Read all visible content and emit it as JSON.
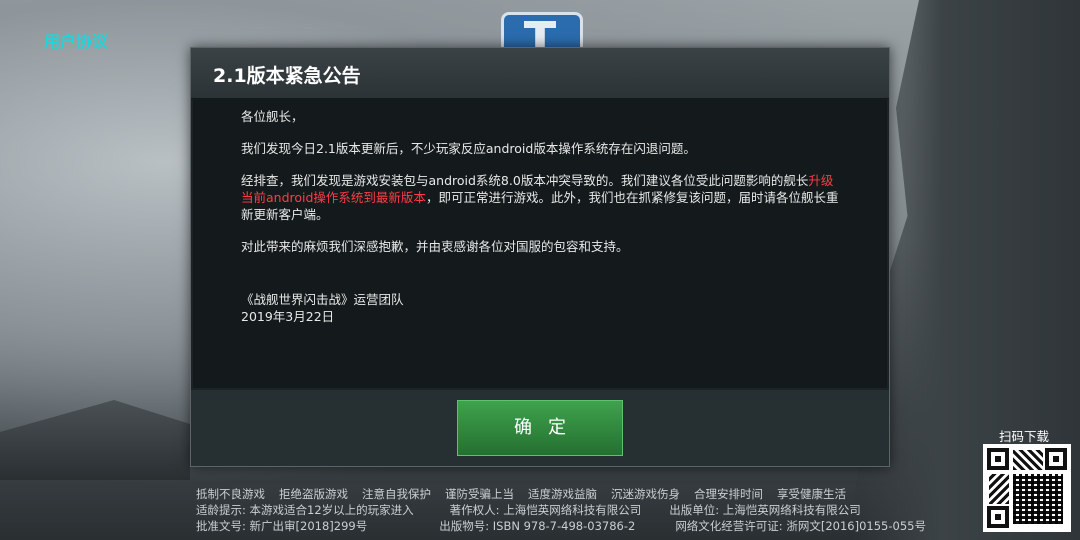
{
  "top_link": "用户协议",
  "dialog": {
    "title": "2.1版本紧急公告",
    "salutation": "各位舰长，",
    "p1": "我们发现今日2.1版本更新后，不少玩家反应android版本操作系统存在闪退问题。",
    "p2_a": "经排查，我们发现是游戏安装包与android系统8.0版本冲突导致的。我们建议各位受此问题影响的舰长",
    "p2_red": "升级当前android操作系统到最新版本",
    "p2_b": "，即可正常进行游戏。此外，我们也在抓紧修复该问题，届时请各位舰长重新更新客户端。",
    "p3": "对此带来的麻烦我们深感抱歉，并由衷感谢各位对国服的包容和支持。",
    "sig_team": "《战舰世界闪击战》运营团队",
    "sig_date": "2019年3月22日",
    "ok_label": "确定"
  },
  "footer": {
    "line1": [
      "抵制不良游戏",
      "拒绝盗版游戏",
      "注意自我保护",
      "谨防受骗上当",
      "适度游戏益脑",
      "沉迷游戏伤身",
      "合理安排时间",
      "享受健康生活"
    ],
    "line2": [
      "适龄提示: 本游戏适合12岁以上的玩家进入",
      "著作权人: 上海恺英网络科技有限公司",
      "出版单位: 上海恺英网络科技有限公司"
    ],
    "line3": [
      "批准文号: 新广出审[2018]299号",
      "出版物号: ISBN 978-7-498-03786-2",
      "网络文化经营许可证: 浙网文[2016]0155-055号"
    ]
  },
  "qr_label": "扫码下载",
  "colors": {
    "accent_link": "#22d4d8",
    "ok_button": "#3fa24d",
    "highlight": "#ff3b4a"
  },
  "icons": {
    "emblem": "game-emblem-icon",
    "qr": "qr-code"
  }
}
